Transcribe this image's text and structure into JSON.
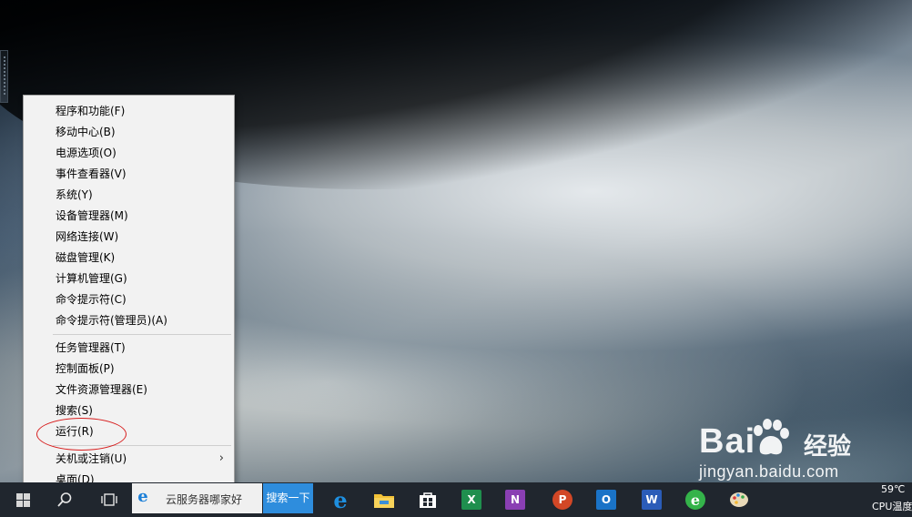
{
  "context_menu": {
    "group1": [
      "程序和功能(F)",
      "移动中心(B)",
      "电源选项(O)",
      "事件查看器(V)",
      "系统(Y)",
      "设备管理器(M)",
      "网络连接(W)",
      "磁盘管理(K)",
      "计算机管理(G)",
      "命令提示符(C)",
      "命令提示符(管理员)(A)"
    ],
    "group2": [
      "任务管理器(T)",
      "控制面板(P)",
      "文件资源管理器(E)",
      "搜索(S)",
      "运行(R)"
    ],
    "group3": [
      "关机或注销(U)",
      "桌面(D)"
    ],
    "submenu_arrow": "›"
  },
  "taskbar": {
    "search_text": "云服务器哪家好",
    "search_button": "搜索一下",
    "ie_glyph": "e",
    "apps": [
      {
        "name": "edge-icon",
        "glyph": "e",
        "color": "#1e8fe0"
      },
      {
        "name": "file-explorer-icon",
        "glyph": "",
        "color": "#f3c237"
      },
      {
        "name": "store-icon",
        "glyph": "",
        "color": "#ffffff"
      },
      {
        "name": "excel-icon",
        "glyph": "X",
        "color": "#1f8f4e"
      },
      {
        "name": "onenote-icon",
        "glyph": "N",
        "color": "#8a3fb3"
      },
      {
        "name": "powerpoint-icon",
        "glyph": "P",
        "color": "#d24726"
      },
      {
        "name": "outlook-icon",
        "glyph": "O",
        "color": "#1a73c7"
      },
      {
        "name": "word-icon",
        "glyph": "W",
        "color": "#2b5cb8"
      },
      {
        "name": "browser-icon",
        "glyph": "e",
        "color": "#34b34a"
      },
      {
        "name": "paint-icon",
        "glyph": "",
        "color": "#6ab0e8"
      }
    ],
    "tray_temp": "59℃",
    "tray_cpu": "CPU温度"
  },
  "watermark": {
    "brand_left": "Bai",
    "brand_right": "经验",
    "url": "jingyan.baidu.com"
  },
  "colors": {
    "highlight_circle": "#d71d1d",
    "taskbar": "#20262e",
    "search_button": "#2e8ddd"
  }
}
